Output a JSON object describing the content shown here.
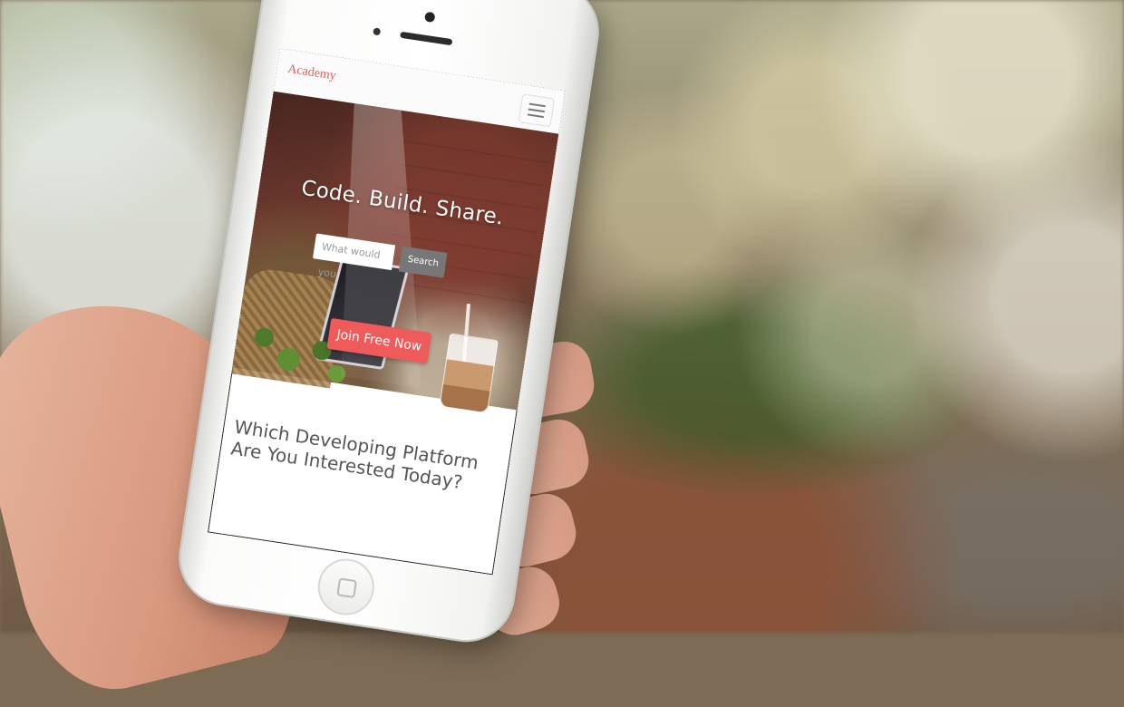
{
  "app": {
    "brand": "Academy"
  },
  "hero": {
    "title": "Code. Build. Share.",
    "search_placeholder": "What would you",
    "search_button": "Search",
    "cta_button": "Join Free Now"
  },
  "section": {
    "title_line1": "Which Developing Platform",
    "title_line2": "Are You Interested Today?"
  },
  "colors": {
    "accent": "#ef5a5a",
    "brand": "#e65a5a",
    "search_button": "#777777"
  },
  "icons": {
    "menu": "hamburger-menu-icon",
    "home": "home-button"
  }
}
